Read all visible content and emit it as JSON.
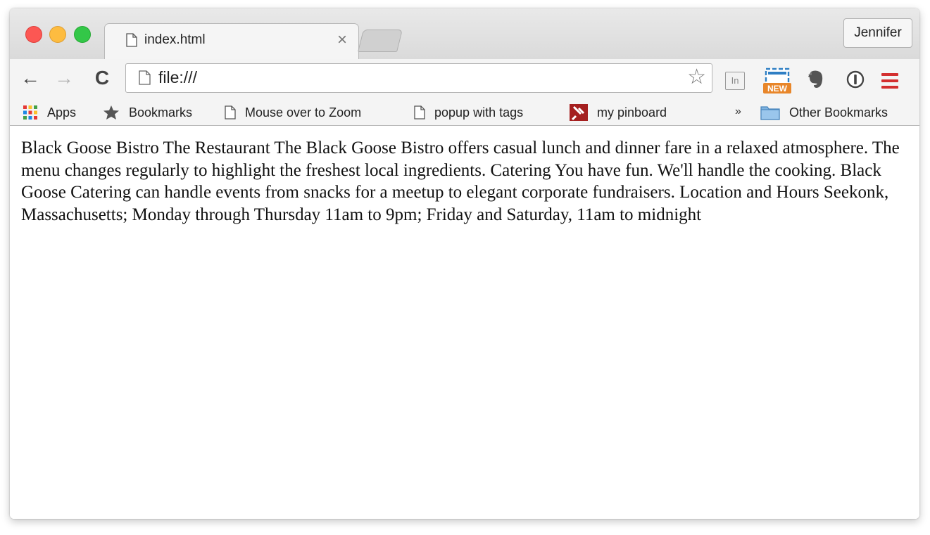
{
  "window": {
    "tab": {
      "title": "index.html",
      "close_label": "×"
    },
    "profile_button": "Jennifer"
  },
  "toolbar": {
    "back_label": "←",
    "forward_label": "→",
    "reload_label": "C",
    "address": {
      "url": "file:///"
    },
    "star_label": "☆",
    "extensions": [
      {
        "name": "linkedin-icon",
        "label": "In"
      },
      {
        "name": "screenshot-new-icon",
        "badge": "NEW"
      },
      {
        "name": "evernote-icon"
      },
      {
        "name": "1password-icon"
      },
      {
        "name": "chrome-menu-icon"
      }
    ]
  },
  "bookmarks_bar": {
    "items": [
      {
        "label": "Apps",
        "icon": "apps-grid-icon"
      },
      {
        "label": "Bookmarks",
        "icon": "star-icon"
      },
      {
        "label": "Mouse over to Zoom",
        "icon": "page-icon"
      },
      {
        "label": "popup with tags",
        "icon": "page-icon"
      },
      {
        "label": "my pinboard",
        "icon": "pinboard-icon"
      }
    ],
    "overflow_label": "»",
    "other": {
      "label": "Other Bookmarks",
      "icon": "folder-icon"
    }
  },
  "page": {
    "text": "Black Goose Bistro The Restaurant The Black Goose Bistro offers casual lunch and dinner fare in a relaxed atmosphere. The menu changes regularly to highlight the freshest local ingredients. Catering You have fun. We'll handle the cooking. Black Goose Catering can handle events from snacks for a meetup to elegant corporate fundraisers. Location and Hours Seekonk, Massachusetts; Monday through Thursday 11am to 9pm; Friday and Saturday, 11am to midnight"
  },
  "colors": {
    "close": "#fc5753",
    "minimize": "#fdbc40",
    "maximize": "#33c748",
    "menu_red": "#d32f2f",
    "new_badge": "#e8862a",
    "folder_blue": "#7fb3e0"
  }
}
